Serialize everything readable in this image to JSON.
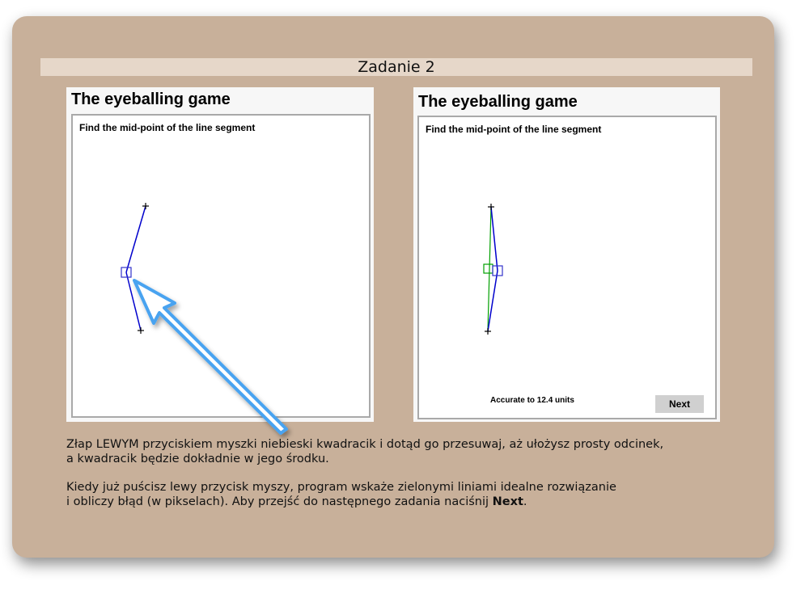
{
  "header": {
    "title": "Zadanie 2"
  },
  "left_panel": {
    "title": "The eyeballing game",
    "instruction": "Find the mid-point of the line segment"
  },
  "right_panel": {
    "title": "The eyeballing game",
    "instruction": "Find the mid-point of the line segment",
    "result": "Accurate to 12.4 units",
    "next_label": "Next"
  },
  "instructions": {
    "line1": "Złap LEWYM przyciskiem myszki niebieski kwadracik i dotąd go przesuwaj, aż ułożysz prosty odcinek,",
    "line2": "a kwadracik będzie dokładnie w jego środku.",
    "line3": "Kiedy już puścisz lewy przycisk myszy, program wskaże zielonymi liniami idealne rozwiązanie",
    "line4_prefix": "i obliczy błąd (w pikselach). Aby przejść do następnego zadania naciśnij ",
    "line4_bold": "Next",
    "line4_suffix": "."
  },
  "colors": {
    "user_line": "#0000cc",
    "ideal_line": "#00a000",
    "arrow": "#4aa3f0"
  },
  "icons": [
    "plus-marker",
    "drag-handle-square",
    "pointer-arrow"
  ]
}
